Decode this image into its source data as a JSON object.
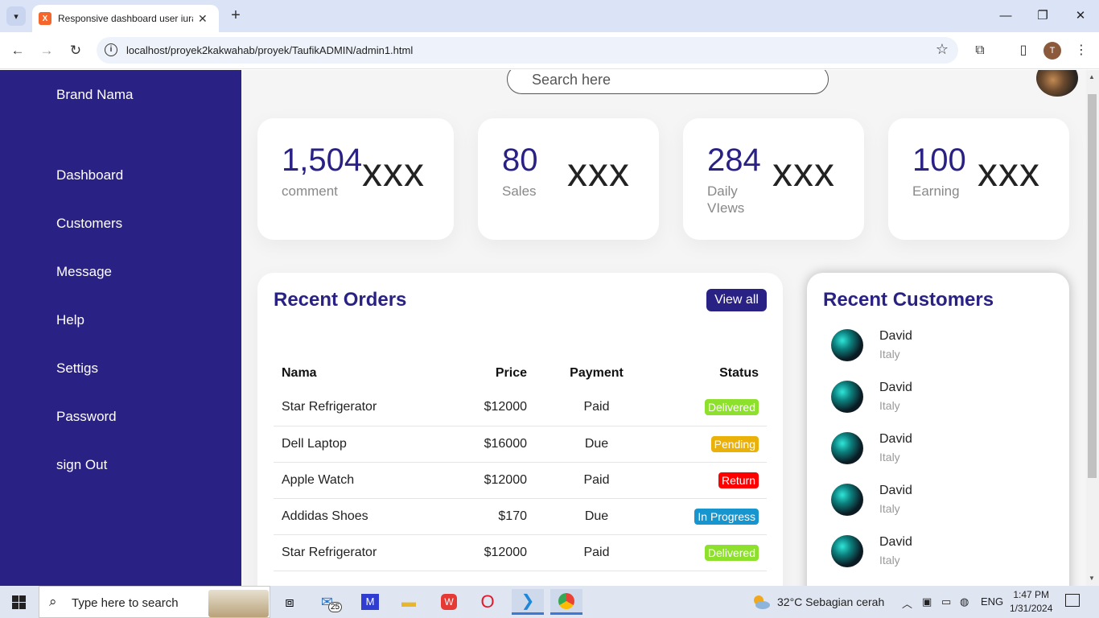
{
  "browser": {
    "tab_title": "Responsive dashboard user iura",
    "url": "localhost/proyek2kakwahab/proyek/TaufikADMIN/admin1.html",
    "profile_initial": "T"
  },
  "sidebar": {
    "brand": "Brand Nama",
    "items": [
      {
        "label": "Dashboard"
      },
      {
        "label": "Customers"
      },
      {
        "label": "Message"
      },
      {
        "label": "Help"
      },
      {
        "label": "Settigs"
      },
      {
        "label": "Password"
      },
      {
        "label": "sign Out"
      }
    ]
  },
  "header": {
    "search_placeholder": "Search here"
  },
  "cards": [
    {
      "number": "1,504",
      "label": "comment",
      "icon": "xxx"
    },
    {
      "number": "80",
      "label": "Sales",
      "icon": "xxx"
    },
    {
      "number": "284",
      "label": "Daily VIews",
      "icon": "xxx"
    },
    {
      "number": "100",
      "label": "Earning",
      "icon": "xxx"
    }
  ],
  "orders": {
    "title": "Recent Orders",
    "view_all": "View all",
    "columns": [
      "Nama",
      "Price",
      "Payment",
      "Status"
    ],
    "rows": [
      {
        "name": "Star Refrigerator",
        "price": "$12000",
        "payment": "Paid",
        "status": "Delivered",
        "status_color": "#8de02c"
      },
      {
        "name": "Dell Laptop",
        "price": "$16000",
        "payment": "Due",
        "status": "Pending",
        "status_color": "#e9b10a"
      },
      {
        "name": "Apple Watch",
        "price": "$12000",
        "payment": "Paid",
        "status": "Return",
        "status_color": "#ff0000"
      },
      {
        "name": "Addidas Shoes",
        "price": "$170",
        "payment": "Due",
        "status": "In Progress",
        "status_color": "#1795ce"
      },
      {
        "name": "Star Refrigerator",
        "price": "$12000",
        "payment": "Paid",
        "status": "Delivered",
        "status_color": "#8de02c"
      }
    ]
  },
  "customers": {
    "title": "Recent Customers",
    "items": [
      {
        "name": "David",
        "country": "Italy"
      },
      {
        "name": "David",
        "country": "Italy"
      },
      {
        "name": "David",
        "country": "Italy"
      },
      {
        "name": "David",
        "country": "Italy"
      },
      {
        "name": "David",
        "country": "Italy"
      }
    ]
  },
  "taskbar": {
    "search_placeholder": "Type here to search",
    "mail_badge": "25",
    "weather": "32°C  Sebagian cerah",
    "language": "ENG",
    "time": "1:47 PM",
    "date": "1/31/2024"
  },
  "colors": {
    "primary": "#2a2185",
    "delivered": "#8de02c",
    "pending": "#e9b10a",
    "return": "#ff0000",
    "in_progress": "#1795ce"
  }
}
